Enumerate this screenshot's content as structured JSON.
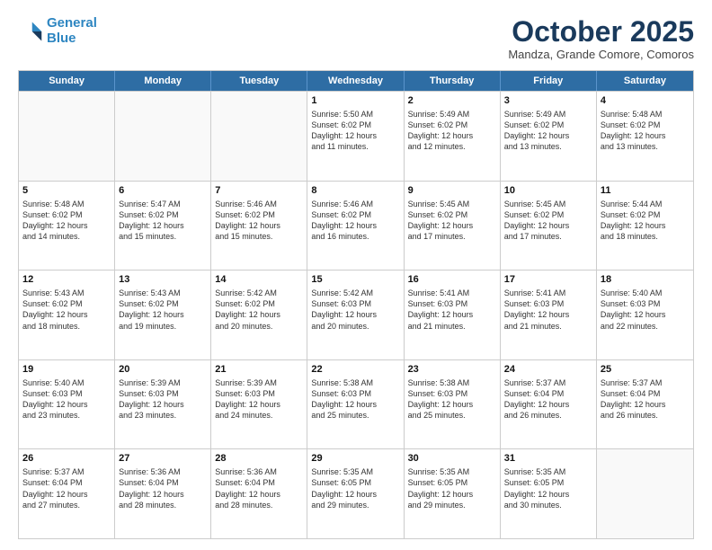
{
  "header": {
    "logo_line1": "General",
    "logo_line2": "Blue",
    "month": "October 2025",
    "location": "Mandza, Grande Comore, Comoros"
  },
  "weekdays": [
    "Sunday",
    "Monday",
    "Tuesday",
    "Wednesday",
    "Thursday",
    "Friday",
    "Saturday"
  ],
  "rows": [
    [
      {
        "day": "",
        "text": ""
      },
      {
        "day": "",
        "text": ""
      },
      {
        "day": "",
        "text": ""
      },
      {
        "day": "1",
        "text": "Sunrise: 5:50 AM\nSunset: 6:02 PM\nDaylight: 12 hours\nand 11 minutes."
      },
      {
        "day": "2",
        "text": "Sunrise: 5:49 AM\nSunset: 6:02 PM\nDaylight: 12 hours\nand 12 minutes."
      },
      {
        "day": "3",
        "text": "Sunrise: 5:49 AM\nSunset: 6:02 PM\nDaylight: 12 hours\nand 13 minutes."
      },
      {
        "day": "4",
        "text": "Sunrise: 5:48 AM\nSunset: 6:02 PM\nDaylight: 12 hours\nand 13 minutes."
      }
    ],
    [
      {
        "day": "5",
        "text": "Sunrise: 5:48 AM\nSunset: 6:02 PM\nDaylight: 12 hours\nand 14 minutes."
      },
      {
        "day": "6",
        "text": "Sunrise: 5:47 AM\nSunset: 6:02 PM\nDaylight: 12 hours\nand 15 minutes."
      },
      {
        "day": "7",
        "text": "Sunrise: 5:46 AM\nSunset: 6:02 PM\nDaylight: 12 hours\nand 15 minutes."
      },
      {
        "day": "8",
        "text": "Sunrise: 5:46 AM\nSunset: 6:02 PM\nDaylight: 12 hours\nand 16 minutes."
      },
      {
        "day": "9",
        "text": "Sunrise: 5:45 AM\nSunset: 6:02 PM\nDaylight: 12 hours\nand 17 minutes."
      },
      {
        "day": "10",
        "text": "Sunrise: 5:45 AM\nSunset: 6:02 PM\nDaylight: 12 hours\nand 17 minutes."
      },
      {
        "day": "11",
        "text": "Sunrise: 5:44 AM\nSunset: 6:02 PM\nDaylight: 12 hours\nand 18 minutes."
      }
    ],
    [
      {
        "day": "12",
        "text": "Sunrise: 5:43 AM\nSunset: 6:02 PM\nDaylight: 12 hours\nand 18 minutes."
      },
      {
        "day": "13",
        "text": "Sunrise: 5:43 AM\nSunset: 6:02 PM\nDaylight: 12 hours\nand 19 minutes."
      },
      {
        "day": "14",
        "text": "Sunrise: 5:42 AM\nSunset: 6:02 PM\nDaylight: 12 hours\nand 20 minutes."
      },
      {
        "day": "15",
        "text": "Sunrise: 5:42 AM\nSunset: 6:03 PM\nDaylight: 12 hours\nand 20 minutes."
      },
      {
        "day": "16",
        "text": "Sunrise: 5:41 AM\nSunset: 6:03 PM\nDaylight: 12 hours\nand 21 minutes."
      },
      {
        "day": "17",
        "text": "Sunrise: 5:41 AM\nSunset: 6:03 PM\nDaylight: 12 hours\nand 21 minutes."
      },
      {
        "day": "18",
        "text": "Sunrise: 5:40 AM\nSunset: 6:03 PM\nDaylight: 12 hours\nand 22 minutes."
      }
    ],
    [
      {
        "day": "19",
        "text": "Sunrise: 5:40 AM\nSunset: 6:03 PM\nDaylight: 12 hours\nand 23 minutes."
      },
      {
        "day": "20",
        "text": "Sunrise: 5:39 AM\nSunset: 6:03 PM\nDaylight: 12 hours\nand 23 minutes."
      },
      {
        "day": "21",
        "text": "Sunrise: 5:39 AM\nSunset: 6:03 PM\nDaylight: 12 hours\nand 24 minutes."
      },
      {
        "day": "22",
        "text": "Sunrise: 5:38 AM\nSunset: 6:03 PM\nDaylight: 12 hours\nand 25 minutes."
      },
      {
        "day": "23",
        "text": "Sunrise: 5:38 AM\nSunset: 6:03 PM\nDaylight: 12 hours\nand 25 minutes."
      },
      {
        "day": "24",
        "text": "Sunrise: 5:37 AM\nSunset: 6:04 PM\nDaylight: 12 hours\nand 26 minutes."
      },
      {
        "day": "25",
        "text": "Sunrise: 5:37 AM\nSunset: 6:04 PM\nDaylight: 12 hours\nand 26 minutes."
      }
    ],
    [
      {
        "day": "26",
        "text": "Sunrise: 5:37 AM\nSunset: 6:04 PM\nDaylight: 12 hours\nand 27 minutes."
      },
      {
        "day": "27",
        "text": "Sunrise: 5:36 AM\nSunset: 6:04 PM\nDaylight: 12 hours\nand 28 minutes."
      },
      {
        "day": "28",
        "text": "Sunrise: 5:36 AM\nSunset: 6:04 PM\nDaylight: 12 hours\nand 28 minutes."
      },
      {
        "day": "29",
        "text": "Sunrise: 5:35 AM\nSunset: 6:05 PM\nDaylight: 12 hours\nand 29 minutes."
      },
      {
        "day": "30",
        "text": "Sunrise: 5:35 AM\nSunset: 6:05 PM\nDaylight: 12 hours\nand 29 minutes."
      },
      {
        "day": "31",
        "text": "Sunrise: 5:35 AM\nSunset: 6:05 PM\nDaylight: 12 hours\nand 30 minutes."
      },
      {
        "day": "",
        "text": ""
      }
    ]
  ]
}
